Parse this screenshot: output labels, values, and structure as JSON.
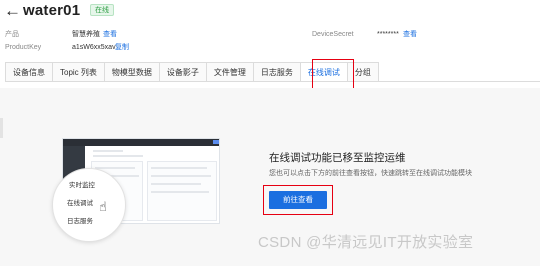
{
  "header": {
    "back_icon": "←",
    "device_name": "water01",
    "status": "在线",
    "product_label": "产品",
    "product_value": "智慧养殖",
    "product_link": "查看",
    "productkey_label": "ProductKey",
    "productkey_value": "a1sW6xx5xav",
    "productkey_link": "复制",
    "secret_label": "DeviceSecret",
    "secret_value": "********",
    "secret_link": "查看"
  },
  "tabs": [
    {
      "label": "设备信息"
    },
    {
      "label": "Topic 列表"
    },
    {
      "label": "物模型数据"
    },
    {
      "label": "设备影子"
    },
    {
      "label": "文件管理"
    },
    {
      "label": "日志服务"
    },
    {
      "label": "在线调试"
    },
    {
      "label": "分组"
    }
  ],
  "active_tab": "在线调试",
  "illustration": {
    "menu_items": [
      "实时监控",
      "在线调试",
      "日志服务"
    ]
  },
  "notice": {
    "title": "在线调试功能已移至监控运维",
    "description": "您也可以点击下方的前往查看按钮，快速跳转至在线调试功能模块",
    "button_label": "前往查看"
  },
  "watermark": "CSDN @华清远见IT开放实验室",
  "colors": {
    "accent": "#1b6fe0",
    "highlight_box": "#e60012",
    "online_green": "#2f9e44"
  }
}
